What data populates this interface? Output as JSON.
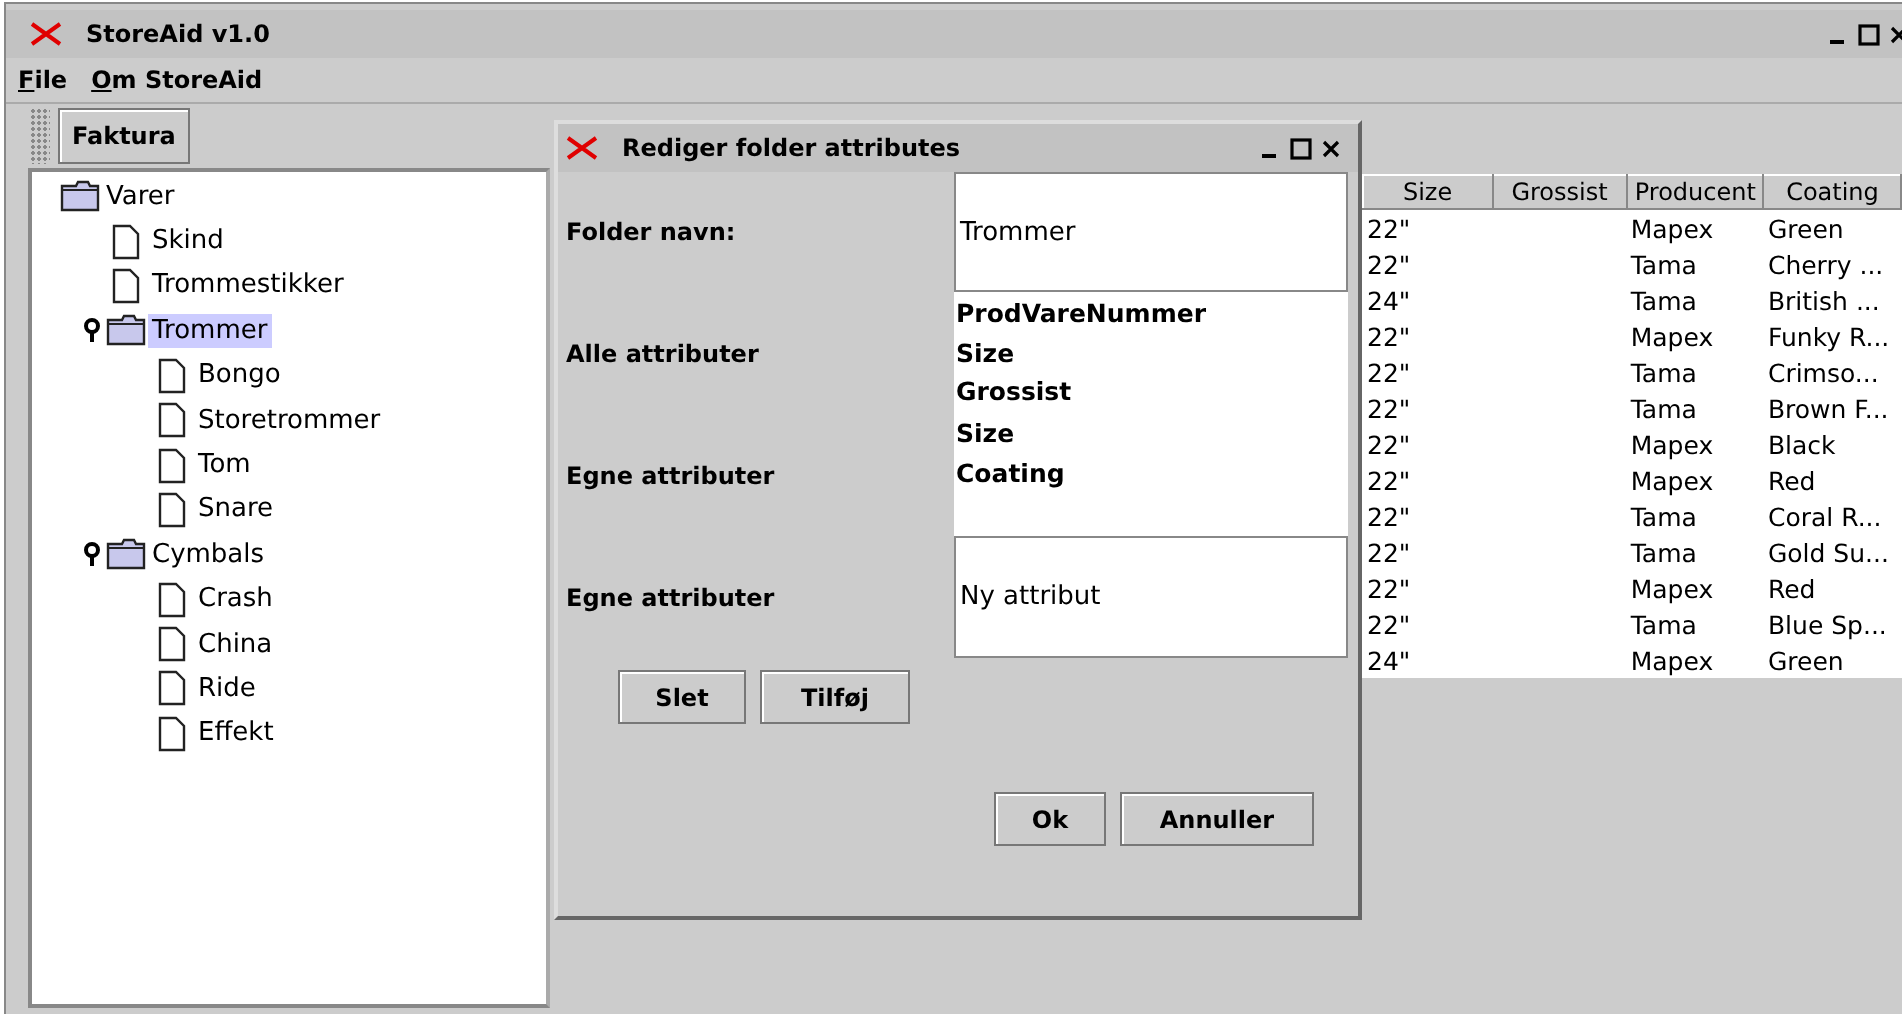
{
  "window": {
    "title": "StoreAid v1.0"
  },
  "menu": [
    {
      "label": "File"
    },
    {
      "label": "Om StoreAid"
    }
  ],
  "toolbar": {
    "buttons": [
      "Faktura"
    ]
  },
  "tree": [
    {
      "label": "Varer",
      "kind": "folder",
      "selected": false,
      "children": [
        {
          "label": "Skind",
          "kind": "file",
          "selected": false
        },
        {
          "label": "Trommestikker",
          "kind": "file",
          "selected": false
        },
        {
          "label": "Trommer",
          "kind": "folder",
          "selected": true,
          "expanded": true,
          "children": [
            {
              "label": "Bongo",
              "kind": "file",
              "selected": false
            },
            {
              "label": "Storetrommer",
              "kind": "file",
              "selected": false
            },
            {
              "label": "Tom",
              "kind": "file",
              "selected": false
            },
            {
              "label": "Snare",
              "kind": "file",
              "selected": false
            }
          ]
        },
        {
          "label": "Cymbals",
          "kind": "folder",
          "selected": false,
          "expanded": true,
          "children": [
            {
              "label": "Crash",
              "kind": "file",
              "selected": false
            },
            {
              "label": "China",
              "kind": "file",
              "selected": false
            },
            {
              "label": "Ride",
              "kind": "file",
              "selected": false
            },
            {
              "label": "Effekt",
              "kind": "file",
              "selected": false
            }
          ]
        }
      ]
    }
  ],
  "table": {
    "columns": [
      "Size",
      "Grossist",
      "Producent",
      "Coating"
    ],
    "rows": [
      [
        "22\"",
        "",
        "Mapex",
        "Green"
      ],
      [
        "22\"",
        "",
        "Tama",
        "Cherry ..."
      ],
      [
        "24\"",
        "",
        "Tama",
        "British ..."
      ],
      [
        "22\"",
        "",
        "Mapex",
        "Funky R..."
      ],
      [
        "22\"",
        "",
        "Tama",
        "Crimso..."
      ],
      [
        "22\"",
        "",
        "Tama",
        "Brown F..."
      ],
      [
        "22\"",
        "",
        "Mapex",
        "Black"
      ],
      [
        "22\"",
        "",
        "Mapex",
        "Red"
      ],
      [
        "22\"",
        "",
        "Tama",
        "Coral R..."
      ],
      [
        "22\"",
        "",
        "Tama",
        "Gold Su..."
      ],
      [
        "22\"",
        "",
        "Mapex",
        "Red"
      ],
      [
        "22\"",
        "",
        "Tama",
        "Blue Sp..."
      ],
      [
        "24\"",
        "",
        "Mapex",
        "Green"
      ]
    ]
  },
  "dialog": {
    "title": "Rediger folder attributes",
    "folder_name": {
      "label": "Folder navn:",
      "value": "Trommer"
    },
    "all_attributes": {
      "label": "Alle attributer",
      "items": [
        "ProdVareNummer",
        "Size",
        "Grossist"
      ]
    },
    "own_attributes": {
      "label": "Egne attributer",
      "items": [
        "Size",
        "Coating"
      ]
    },
    "new_attribute": {
      "label": "Egne attributer",
      "value": "Ny attribut"
    },
    "list_buttons": [
      "Slet",
      "Tilføj"
    ],
    "buttons": [
      "Ok",
      "Annuller"
    ]
  }
}
